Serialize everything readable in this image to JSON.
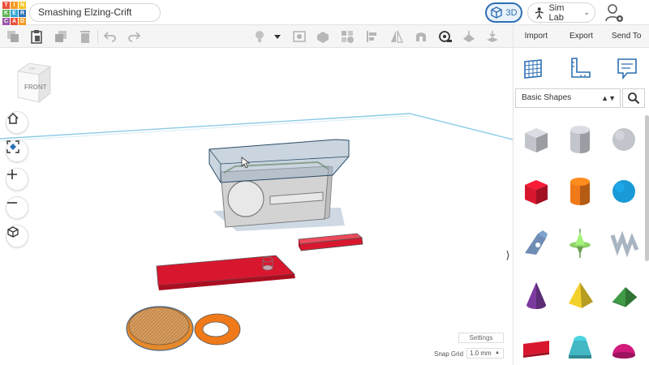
{
  "app": {
    "logo_letters": [
      "T",
      "I",
      "N",
      "K",
      "E",
      "R",
      "C",
      "A",
      "D"
    ],
    "logo_colors": [
      "#e8503a",
      "#f59a25",
      "#f8c221",
      "#5fb554",
      "#2fa5d6",
      "#2d6fb3",
      "#9a57a8",
      "#e8503a",
      "#f59a25"
    ],
    "project_title": "Smashing Elzing-Crift",
    "view_3d_label": "3D",
    "sim_lab_label": "Sim Lab"
  },
  "toolbar": {
    "tools": [
      "copy-icon",
      "paste-icon",
      "duplicate-icon",
      "delete-icon",
      "undo-icon",
      "redo-icon",
      "light-bulb-icon",
      "shape-dropdown-icon",
      "note-icon",
      "hole-solid-icon",
      "group-icon",
      "ungroup-icon",
      "align-icon",
      "mirror-icon",
      "cruise-icon",
      "ruler-icon",
      "workplane-icon",
      "drop-icon"
    ]
  },
  "right_actions": {
    "import": "Import",
    "export": "Export",
    "send_to": "Send To"
  },
  "view_cube": {
    "label": "FRONT",
    "top_label": "TOP"
  },
  "nav_buttons": [
    "home-icon",
    "fit-view-icon",
    "zoom-in-icon",
    "zoom-out-icon",
    "perspective-icon"
  ],
  "workplane": {
    "settings_label": "Settings",
    "snap_grid_label": "Snap Grid",
    "snap_grid_value": "1.0 mm"
  },
  "panel": {
    "tabs": [
      "grid-panel-icon",
      "ruler-panel-icon",
      "notes-panel-icon"
    ],
    "shape_category": "Basic Shapes",
    "shapes": [
      {
        "name": "box-hole",
        "color": "#b8bcc2"
      },
      {
        "name": "cylinder-hole",
        "color": "#b8bcc2"
      },
      {
        "name": "sphere-hole",
        "color": "#b8bcc2"
      },
      {
        "name": "box",
        "color": "#d8172f"
      },
      {
        "name": "cylinder",
        "color": "#f07a1a"
      },
      {
        "name": "sphere",
        "color": "#1a9ad6"
      },
      {
        "name": "scribble",
        "color": "#6f8db4"
      },
      {
        "name": "shape-generator",
        "color": "#8fd36b"
      },
      {
        "name": "text-shape-gray",
        "color": "#a9b4c2"
      },
      {
        "name": "cone",
        "color": "#7b3a9e"
      },
      {
        "name": "pyramid",
        "color": "#f4d12a"
      },
      {
        "name": "roof",
        "color": "#3f9b46"
      },
      {
        "name": "text",
        "color": "#d8172f"
      },
      {
        "name": "half-cylinder",
        "color": "#41b8c4"
      },
      {
        "name": "half-sphere",
        "color": "#d11a7a"
      }
    ]
  }
}
